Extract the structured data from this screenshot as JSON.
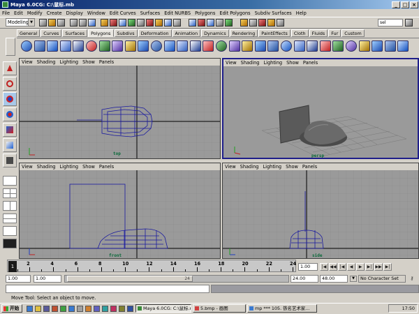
{
  "window": {
    "title": "Maya 6.0CG: C:\\鼠标.mb",
    "minimize": "_",
    "maximize": "□",
    "close": "×"
  },
  "menubar": [
    "File",
    "Edit",
    "Modify",
    "Create",
    "Display",
    "Window",
    "Edit Curves",
    "Surfaces",
    "Edit NURBS",
    "Polygons",
    "Edit Polygons",
    "Subdiv Surfaces",
    "Help"
  ],
  "statusline": {
    "mode": "Modeling",
    "right_field": "sel"
  },
  "shelf_tabs": [
    {
      "label": "General",
      "active": false
    },
    {
      "label": "Curves",
      "active": false
    },
    {
      "label": "Surfaces",
      "active": false
    },
    {
      "label": "Polygons",
      "active": true
    },
    {
      "label": "Subdivs",
      "active": false
    },
    {
      "label": "Deformation",
      "active": false
    },
    {
      "label": "Animation",
      "active": false
    },
    {
      "label": "Dynamics",
      "active": false
    },
    {
      "label": "Rendering",
      "active": false
    },
    {
      "label": "PaintEffects",
      "active": false
    },
    {
      "label": "Cloth",
      "active": false
    },
    {
      "label": "Fluids",
      "active": false
    },
    {
      "label": "Fur",
      "active": false
    },
    {
      "label": "Custom",
      "active": false
    }
  ],
  "viewport_menu": [
    "View",
    "Shading",
    "Lighting",
    "Show",
    "Panels"
  ],
  "viewports": {
    "top": {
      "label": "top",
      "active": false
    },
    "persp": {
      "label": "persp",
      "active": true
    },
    "front": {
      "label": "front",
      "active": false
    },
    "side": {
      "label": "side",
      "active": false
    }
  },
  "timeline": {
    "ticks": [
      "2",
      "4",
      "6",
      "8",
      "10",
      "12",
      "14",
      "16",
      "18",
      "20",
      "22",
      "24"
    ],
    "start_frame_marker": "1",
    "current_frame": "1.00",
    "playback_buttons": [
      "|◀",
      "◀◀",
      "|◀",
      "◀",
      "▶",
      "▶|",
      "▶▶",
      "▶|"
    ]
  },
  "range": {
    "start": "1.00",
    "playback_start": "1.00",
    "thumb_label": "24",
    "playback_end": "24.00",
    "end": "48.00",
    "character_set": "No Character Set"
  },
  "help_line": "Move Tool: Select an object to move.",
  "taskbar": {
    "start": "开始",
    "tasks": [
      {
        "label": "Maya 6.0CG: C:\\鼠标.mb",
        "active": true
      },
      {
        "label": "5.bmp - 画图",
        "active": false
      },
      {
        "label": "mp *** 105. 铁名艺术家...",
        "active": false
      }
    ],
    "clock": "17:50"
  }
}
